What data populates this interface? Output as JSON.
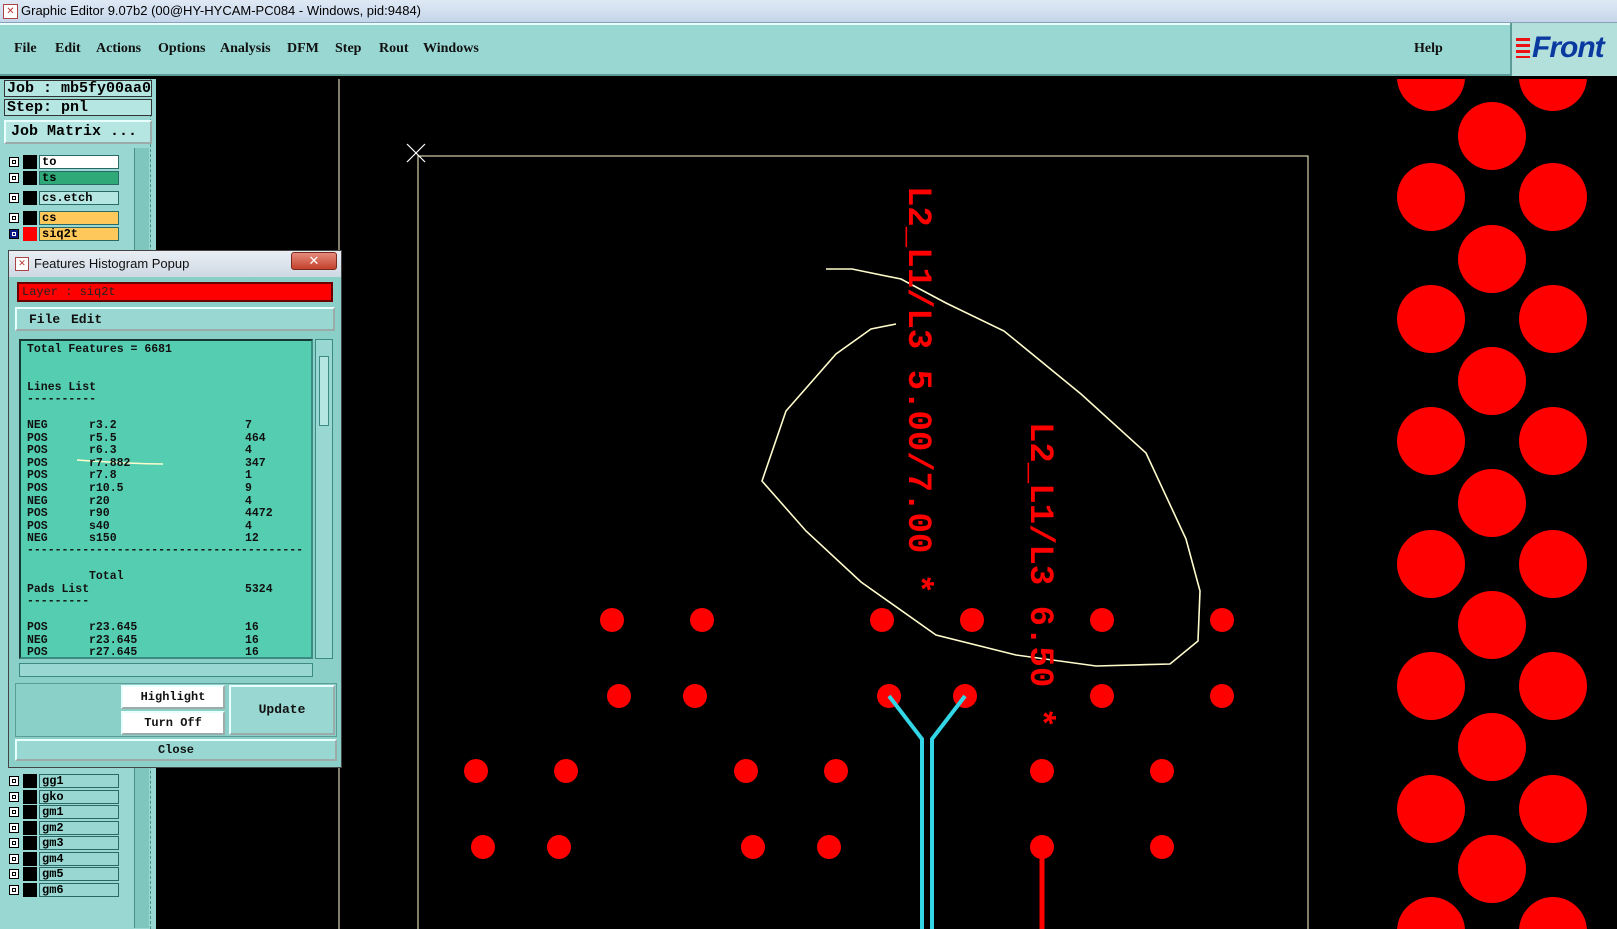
{
  "window": {
    "title": "Graphic Editor 9.07b2 (00@HY-HYCAM-PC084 - Windows, pid:9484)"
  },
  "menu": {
    "items": [
      "File",
      "Edit",
      "Actions",
      "Options",
      "Analysis",
      "DFM",
      "Step",
      "Rout",
      "Windows"
    ],
    "help": "Help",
    "logo": "Front"
  },
  "job": {
    "job_label": "Job : mb5fy00aa0",
    "step_label": "Step: pnl",
    "matrix_button": "Job Matrix ..."
  },
  "layers_top": [
    {
      "name": "to",
      "color": "#ffffff",
      "mark": "#000000"
    },
    {
      "name": "ts",
      "color": "#2fa978",
      "mark": "#000000"
    },
    {
      "name": "cs.etch",
      "color": "#b6e6e1",
      "mark": "#000000"
    },
    {
      "name": "cs",
      "color": "#ffc85a",
      "mark": "#000000"
    },
    {
      "name": "siq2t",
      "color": "#ffc85a",
      "mark": "#ff0000",
      "selected": true
    }
  ],
  "layers_bottom": [
    "gg1",
    "gko",
    "gm1",
    "gm2",
    "gm3",
    "gm4",
    "gm5",
    "gm6"
  ],
  "popup": {
    "title": "Features Histogram Popup",
    "close_symbol": "✕",
    "layer_label": "Layer :  siq2t",
    "menu": [
      "File",
      "Edit"
    ],
    "total_features": "Total Features = 6681",
    "lines_header": "Lines List",
    "lines_underline": "----------",
    "lines": [
      [
        "NEG",
        "r3.2",
        "7"
      ],
      [
        "POS",
        "r5.5",
        "464"
      ],
      [
        "POS",
        "r6.3",
        "4"
      ],
      [
        "POS",
        "r7.882",
        "347"
      ],
      [
        "POS",
        "r7.8",
        "1"
      ],
      [
        "POS",
        "r10.5",
        "9"
      ],
      [
        "NEG",
        "r20",
        "4"
      ],
      [
        "POS",
        "r90",
        "4472"
      ],
      [
        "POS",
        "s40",
        "4"
      ],
      [
        "NEG",
        "s150",
        "12"
      ]
    ],
    "lines_rule": "----------------------------------------",
    "lines_total_label": "Total",
    "lines_total": "5324",
    "pads_header": "Pads List",
    "pads_underline": "---------",
    "pads": [
      [
        "POS",
        "r23.645",
        "16"
      ],
      [
        "NEG",
        "r23.645",
        "16"
      ],
      [
        "POS",
        "r27.645",
        "16"
      ]
    ],
    "buttons": {
      "highlight": "Highlight",
      "turn_off": "Turn Off",
      "update": "Update",
      "close": "Close"
    }
  },
  "canvas": {
    "text_1": "L2_L1/L3 5.00/7.00 *",
    "text_2": "L2_L1/L3 6.50 *",
    "pad_color": "#ff0000",
    "trace_color": "#33d6e6",
    "outline_color": "#fffccc"
  }
}
